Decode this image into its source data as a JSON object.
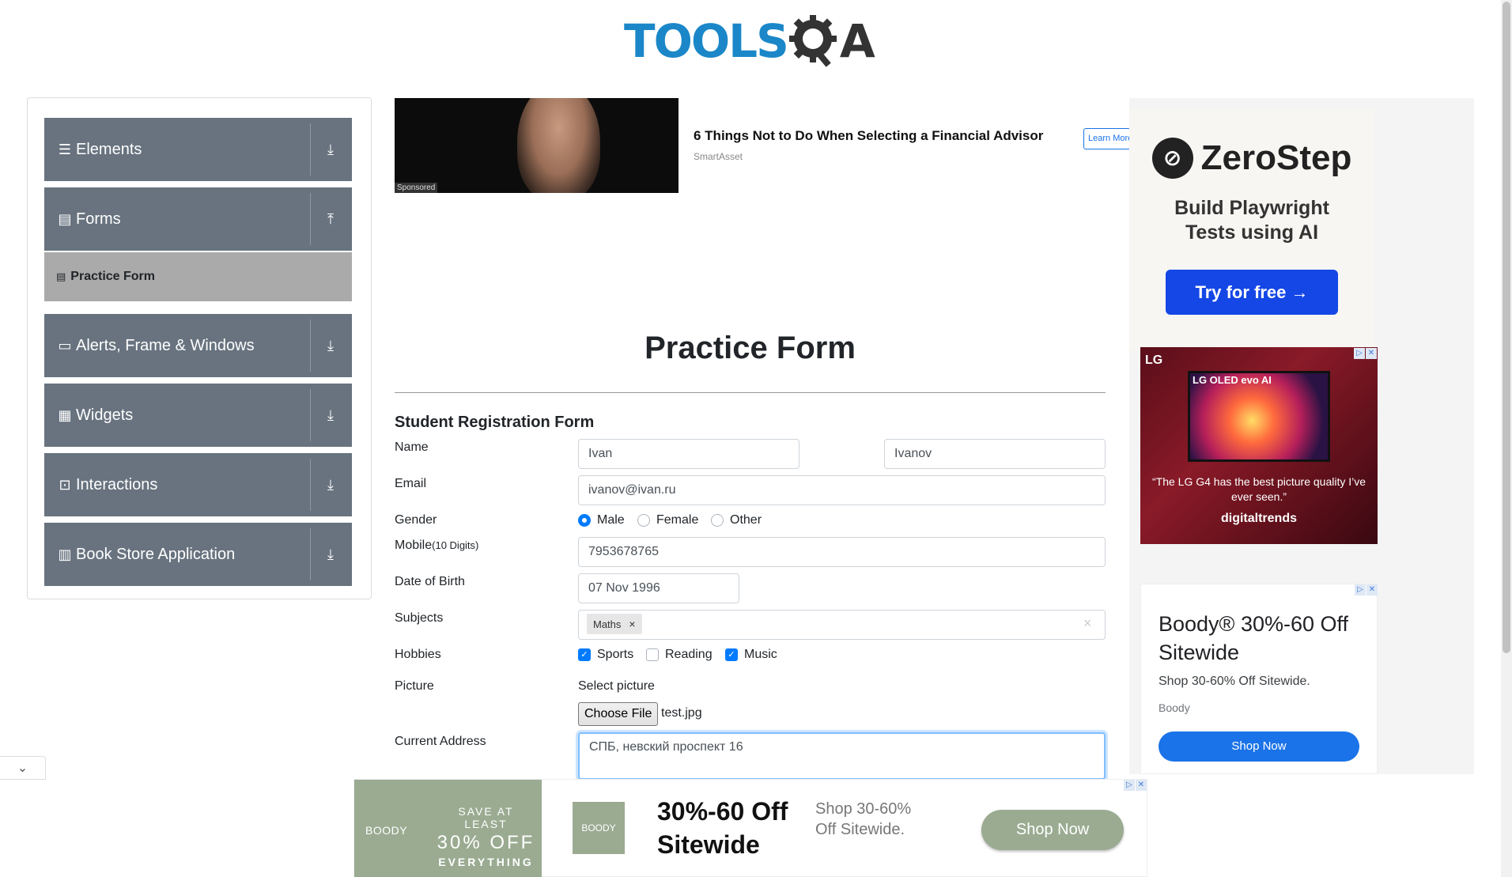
{
  "header": {
    "logo_text_a": "TOOLS",
    "logo_text_b": "A",
    "logo_icon": "gear-q-icon"
  },
  "sidebar": {
    "groups": [
      {
        "label": "Elements",
        "icon": "hamburger-icon",
        "arrow": "download-arrow-icon"
      },
      {
        "label": "Forms",
        "icon": "document-icon",
        "arrow": "upload-arrow-icon"
      },
      {
        "label": "Alerts, Frame & Windows",
        "icon": "window-icon",
        "arrow": "download-arrow-icon"
      },
      {
        "label": "Widgets",
        "icon": "grid-icon",
        "arrow": "download-arrow-icon"
      },
      {
        "label": "Interactions",
        "icon": "interaction-icon",
        "arrow": "download-arrow-icon"
      },
      {
        "label": "Book Store Application",
        "icon": "books-icon",
        "arrow": "download-arrow-icon"
      }
    ],
    "active_item": "Practice Form"
  },
  "ad_top": {
    "sponsored": "Sponsored",
    "title": "6 Things Not to Do When Selecting a Financial Advisor",
    "source": "SmartAsset",
    "button": "Learn More"
  },
  "form": {
    "page_title": "Practice Form",
    "heading": "Student Registration Form",
    "labels": {
      "name": "Name",
      "email": "Email",
      "gender": "Gender",
      "mobile": "Mobile",
      "mobile_hint": "(10 Digits)",
      "dob": "Date of Birth",
      "subjects": "Subjects",
      "hobbies": "Hobbies",
      "picture": "Picture",
      "address": "Current Address"
    },
    "first_name": "Ivan",
    "last_name": "Ivanov",
    "email": "ivanov@ivan.ru",
    "gender_options": [
      "Male",
      "Female",
      "Other"
    ],
    "gender_selected": "Male",
    "mobile": "7953678765",
    "dob": "07 Nov 1996",
    "subjects": [
      "Maths"
    ],
    "subject_remove": "×",
    "subjects_clear": "×",
    "hobbies": [
      {
        "label": "Sports",
        "checked": true
      },
      {
        "label": "Reading",
        "checked": false
      },
      {
        "label": "Music",
        "checked": true
      }
    ],
    "picture_label": "Select picture",
    "file_button": "Choose File",
    "file_name": "test.jpg",
    "address": "СПБ, невский проспект 16"
  },
  "ad_right": {
    "zerostep": {
      "brand": "ZeroStep",
      "tagline_1": "Build Playwright",
      "tagline_2": "Tests using AI",
      "cta": "Try for free →"
    },
    "lg": {
      "brand": "LG",
      "tv_title": "LG OLED evo AI",
      "quote": "“The LG G4 has the best picture quality I’ve ever seen.”",
      "source": "digitaltrends"
    },
    "boody": {
      "title": "Boody® 30%-60 Off Sitewide",
      "subtitle": "Shop 30-60% Off Sitewide.",
      "brand": "Boody",
      "cta": "Shop Now"
    }
  },
  "banner": {
    "logo": "BOODY",
    "save_1": "SAVE AT LEAST",
    "save_2": "30% OFF",
    "save_3": "EVERYTHING",
    "square_logo": "BOODY",
    "headline": "30%-60 Off Sitewide",
    "sub": "Shop 30-60% Off Sitewide.",
    "cta": "Shop Now"
  },
  "colors": {
    "accent": "#007bff",
    "sidebar": "#68737f",
    "active": "#aaaaaa"
  }
}
